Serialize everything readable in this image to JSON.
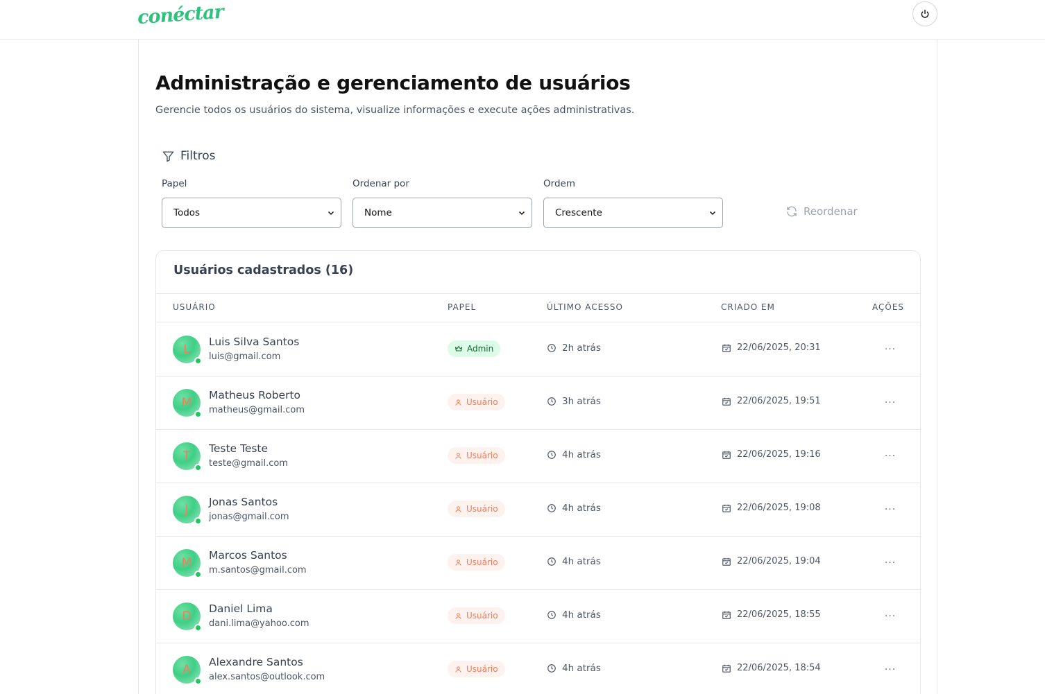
{
  "header": {
    "logo_text": "conéctar",
    "power_icon": "power-icon"
  },
  "page": {
    "title": "Administração e gerenciamento de usuários",
    "subtitle": "Gerencie todos os usuários do sistema, visualize informações e execute ações administrativas."
  },
  "filters": {
    "title": "Filtros",
    "role_label": "Papel",
    "role_value": "Todos",
    "sort_label": "Ordenar por",
    "sort_value": "Nome",
    "order_label": "Ordem",
    "order_value": "Crescente",
    "reorder_label": "Reordenar"
  },
  "users_card": {
    "title": "Usuários cadastrados (16)",
    "columns": {
      "user": "USUÁRIO",
      "role": "PAPEL",
      "last_access": "ÚLTIMO ACESSO",
      "created_at": "CRIADO EM",
      "actions": "AÇÕES"
    },
    "rows": [
      {
        "initial": "L",
        "name": "Luis Silva Santos",
        "email": "luis@gmail.com",
        "role": "Admin",
        "role_type": "admin",
        "last_access": "2h atrás",
        "created_at": "22/06/2025, 20:31",
        "actions": "···"
      },
      {
        "initial": "M",
        "name": "Matheus Roberto",
        "email": "matheus@gmail.com",
        "role": "Usuário",
        "role_type": "user",
        "last_access": "3h atrás",
        "created_at": "22/06/2025, 19:51",
        "actions": "···"
      },
      {
        "initial": "T",
        "name": "Teste Teste",
        "email": "teste@gmail.com",
        "role": "Usuário",
        "role_type": "user",
        "last_access": "4h atrás",
        "created_at": "22/06/2025, 19:16",
        "actions": "···"
      },
      {
        "initial": "J",
        "name": "Jonas Santos",
        "email": "jonas@gmail.com",
        "role": "Usuário",
        "role_type": "user",
        "last_access": "4h atrás",
        "created_at": "22/06/2025, 19:08",
        "actions": "···"
      },
      {
        "initial": "M",
        "name": "Marcos Santos",
        "email": "m.santos@gmail.com",
        "role": "Usuário",
        "role_type": "user",
        "last_access": "4h atrás",
        "created_at": "22/06/2025, 19:04",
        "actions": "···"
      },
      {
        "initial": "D",
        "name": "Daniel Lima",
        "email": "dani.lima@yahoo.com",
        "role": "Usuário",
        "role_type": "user",
        "last_access": "4h atrás",
        "created_at": "22/06/2025, 18:55",
        "actions": "···"
      },
      {
        "initial": "A",
        "name": "Alexandre Santos",
        "email": "alex.santos@outlook.com",
        "role": "Usuário",
        "role_type": "user",
        "last_access": "4h atrás",
        "created_at": "22/06/2025, 18:54",
        "actions": "···"
      }
    ]
  },
  "colors": {
    "brand_green": "#2ec27e",
    "admin_badge_bg": "#dcfce7",
    "user_badge_fg": "#f47c5c",
    "online": "#22c55e"
  }
}
